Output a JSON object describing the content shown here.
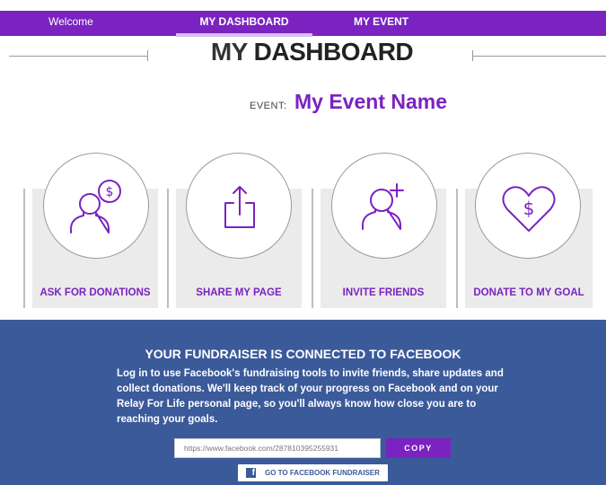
{
  "nav": {
    "welcome": "Welcome",
    "dashboard": "MY DASHBOARD",
    "event": "MY EVENT"
  },
  "title": {
    "prefix": "MY",
    "strong": "DASHBOARD"
  },
  "event": {
    "label": "EVENT:",
    "name": "My Event Name"
  },
  "cards": [
    {
      "label": "ASK FOR DONATIONS",
      "icon": "person-dollar-icon"
    },
    {
      "label": "SHARE MY PAGE",
      "icon": "share-icon"
    },
    {
      "label": "INVITE FRIENDS",
      "icon": "add-person-icon"
    },
    {
      "label": "DONATE TO MY GOAL",
      "icon": "heart-dollar-icon"
    }
  ],
  "facebook": {
    "title": "YOUR FUNDRAISER IS CONNECTED TO FACEBOOK",
    "description": "Log in to use Facebook's fundraising tools to invite friends, share updates and collect donations. We'll keep track of your progress on Facebook and on your Relay For Life personal page, so you'll always know how close you are to reaching your goals.",
    "url": "https://www.facebook.com/287810395255931",
    "copy_label": "COPY",
    "go_label": "GO TO FACEBOOK FUNDRAISER",
    "f_glyph": "f"
  },
  "colors": {
    "accent": "#7a23c0",
    "facebook": "#3b5a9a",
    "card_bg": "#ebebeb"
  }
}
